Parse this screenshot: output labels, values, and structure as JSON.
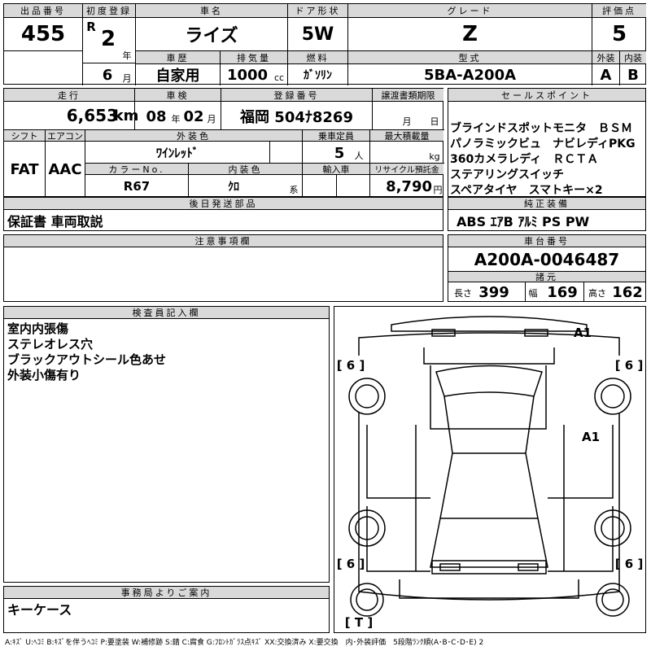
{
  "header": {
    "lot_no_label": "出品番号",
    "lot_no": "455",
    "first_reg_label": "初度登録",
    "era": "R",
    "year": "2",
    "year_unit": "年",
    "month": "6",
    "month_unit": "月",
    "car_name_label": "車名",
    "car_name": "ライズ",
    "door_label": "ドア形状",
    "door": "5W",
    "grade_label": "グレード",
    "grade": "Z",
    "score_label": "評価点",
    "score": "5",
    "history_label": "車歴",
    "history": "自家用",
    "displacement_label": "排気量",
    "displacement": "1000",
    "displacement_unit": "cc",
    "fuel_label": "燃料",
    "fuel": "ｶﾞｿﾘﾝ",
    "model_label": "型式",
    "model": "5BA-A200A",
    "exterior_label": "外装",
    "exterior": "A",
    "interior_label": "内装",
    "interior": "B"
  },
  "row2": {
    "mileage_label": "走行",
    "mileage": "6,653",
    "mileage_unit": "km",
    "inspection_label": "車検",
    "insp_year": "08",
    "insp_year_unit": "年",
    "insp_month": "02",
    "insp_month_unit": "月",
    "plate_label": "登録番号",
    "plate": "福岡 504ﾅ8269",
    "transfer_label": "譲渡書類期限",
    "transfer_month_unit": "月",
    "transfer_day_unit": "日",
    "shift_label": "シフト",
    "shift": "FAT",
    "ac_label": "エアコン",
    "ac": "AAC",
    "color_label": "外装色",
    "color": "ﾜｲﾝﾚｯﾄﾞ",
    "capacity_label": "乗車定員",
    "capacity": "5",
    "capacity_unit": "人",
    "load_label": "最大積載量",
    "load_unit": "kg",
    "color_no_label": "カラーNo.",
    "color_no": "R67",
    "interior_color_label": "内装色",
    "interior_color": "ｸﾛ",
    "interior_color_unit": "系",
    "import_label": "輸入車",
    "recycle_label": "リサイクル預託金",
    "recycle": "8,790",
    "recycle_unit": "円"
  },
  "sales_points": {
    "label": "セールスポイント",
    "lines": [
      "ブラインドスポットモニタ　ＢＳＭ",
      "パノラミックビュ　ナビレディPKG",
      "360カメラレディ　ＲＣＴＡ",
      "ステアリングスイッチ",
      "スペアタイヤ　スマトキー×2"
    ]
  },
  "later_parts": {
    "label": "後日発送部品",
    "value": "保証書 車両取説"
  },
  "equipment": {
    "label": "純正装備",
    "value": "ABS ｴｱB ｱﾙﾐ PS PW"
  },
  "notes": {
    "label": "注意事項欄"
  },
  "chassis": {
    "label": "車台番号",
    "value": "A200A-0046487"
  },
  "dims": {
    "label": "諸元",
    "length_label": "長さ",
    "length": "399",
    "width_label": "幅",
    "width": "169",
    "height_label": "高さ",
    "height": "162"
  },
  "inspector": {
    "label": "検査員記入欄",
    "lines": [
      "室内内張傷",
      "ステレオレス穴",
      "ブラックアウトシール色あせ",
      "外装小傷有り"
    ]
  },
  "diagram": {
    "marks": [
      "A1",
      "A1"
    ],
    "tire_marks": [
      "[ 6 ]",
      "[ 6 ]",
      "[ 6 ]",
      "[ 6 ]"
    ],
    "spare": "[ T ]"
  },
  "office": {
    "label": "事務局よりご案内",
    "value": "キーケース"
  },
  "legend": "A:ｷｽﾞ U:ﾍｺﾐ B:ｷｽﾞを伴うﾍｺﾐ P:要塗装 W:補修跡 S:錆 C:腐食 G:ﾌﾛﾝﾄｶﾞﾗｽ点ｷｽﾞ XX:交換済み X:要交換　内･外装評価　5段階ﾗﾝｸ順(A･B･C･D･E) 2"
}
